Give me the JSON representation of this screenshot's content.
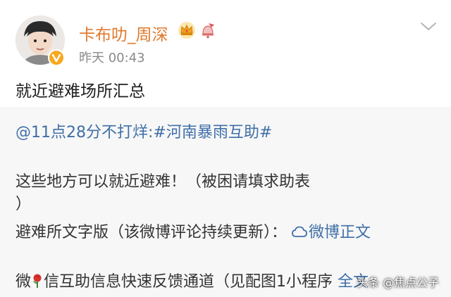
{
  "user": {
    "name": "卡布叻_周深",
    "timestamp": "昨天 00:43",
    "name_color": "#e07a2e",
    "verified_color": "#f7a81d"
  },
  "post": {
    "text": "就近避难场所汇总"
  },
  "repost": {
    "mention": "@11点28分不打烊",
    "hashtag": ":#河南暴雨互助#",
    "line2": "这些地方可以就近避难！（被困请填求助表",
    "line3": "）",
    "line4_text": "避难所文字版（该微博评论持续更新）：",
    "line4_link": "微博正文",
    "line5_pre": "微",
    "line5_post": "信互助信息快速反馈通道（见配图1小程序",
    "line5_link": "全文",
    "link_color": "#3f6fa8",
    "background": "#f7f7f7"
  },
  "watermark": {
    "text": "头条 @焦点公子"
  },
  "icons": {
    "badge1": "crown-badge-icon",
    "badge2": "bell-badge-icon",
    "menu": "chevron-down-icon",
    "link": "weibo-link-icon",
    "rose": "rose-icon",
    "verified": "verified-v-icon"
  }
}
